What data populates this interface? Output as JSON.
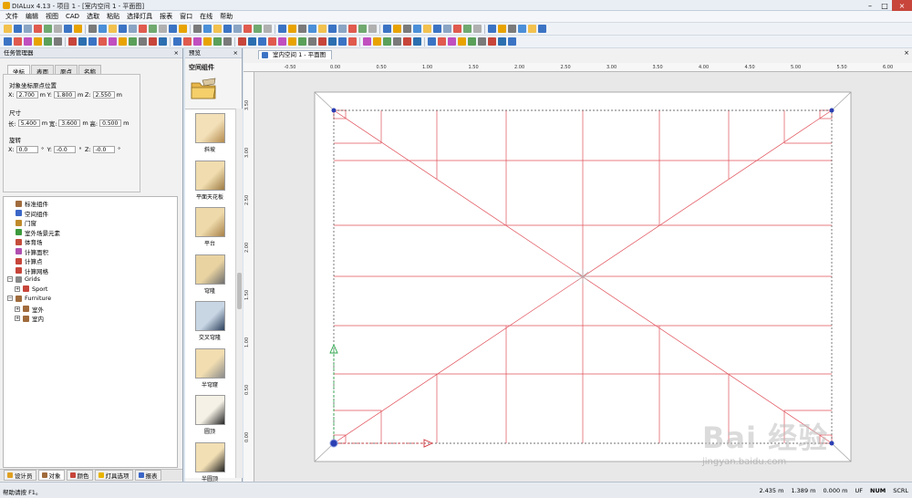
{
  "window": {
    "title": "DIALux 4.13 - 项目 1 - [室内空间 1 - 平面图]"
  },
  "menu": [
    "文件",
    "编辑",
    "视图",
    "CAD",
    "选取",
    "粘贴",
    "选择灯具",
    "报表",
    "窗口",
    "在线",
    "帮助"
  ],
  "task_manager": {
    "header": "任务管理器",
    "tabs": [
      "坐标",
      "表面",
      "原点",
      "名称"
    ],
    "position": {
      "title": "对象坐标原点位置",
      "x_label": "X:",
      "x": "2.700",
      "y_label": "Y:",
      "y": "1.800",
      "z_label": "Z:",
      "z": "2.550",
      "unit": "m"
    },
    "size": {
      "title": "尺寸",
      "l_label": "长:",
      "l": "5.400",
      "w_label": "宽:",
      "w": "3.600",
      "h_label": "高:",
      "h": "0.500",
      "unit": "m"
    },
    "rotation": {
      "title": "旋转",
      "x_label": "X:",
      "x": "0.0",
      "y_label": "Y:",
      "y": "-0.0",
      "z_label": "Z:",
      "z": "-0.0",
      "unit": "°"
    }
  },
  "tree": {
    "items": [
      {
        "label": "标准组件",
        "color": "#a06b3c"
      },
      {
        "label": "空间组件",
        "color": "#3a66c7"
      },
      {
        "label": "门窗",
        "color": "#c08a2a"
      },
      {
        "label": "室外场景元素",
        "color": "#3c9a3c"
      },
      {
        "label": "体育场",
        "color": "#c44d3a"
      },
      {
        "label": "计算面积",
        "color": "#b04fb0"
      },
      {
        "label": "计算点",
        "color": "#c7453a"
      },
      {
        "label": "计算网格",
        "color": "#c7453a"
      },
      {
        "label": "Grids",
        "color": "#888888"
      },
      {
        "label": "Sport",
        "color": "#c7453a"
      },
      {
        "label": "Furniture",
        "color": "#a06b3c"
      },
      {
        "label": "室外",
        "color": "#a06b3c"
      },
      {
        "label": "室内",
        "color": "#a06b3c"
      }
    ]
  },
  "bottom_tabs": [
    {
      "label": "设计员",
      "color": "#e0a020"
    },
    {
      "label": "对象",
      "color": "#a06b3c"
    },
    {
      "label": "颜色",
      "color": "#c7453a"
    },
    {
      "label": "灯具选项",
      "color": "#e8b400"
    },
    {
      "label": "报表",
      "color": "#3a66c7"
    }
  ],
  "preview": {
    "header": "预览",
    "close": "×",
    "title": "空间组件",
    "items": [
      {
        "label": "斜坡",
        "top": "#f3e0b8",
        "side": "#b48a4d"
      },
      {
        "label": "平面天花板",
        "top": "#f0dcae",
        "side": "#9c7a44"
      },
      {
        "label": "平台",
        "top": "#eed9aa",
        "side": "#a68048"
      },
      {
        "label": "穹隆",
        "top": "#e9d3a1",
        "side": "#6e6e6e"
      },
      {
        "label": "交叉穹隆",
        "top": "#c8d6e4",
        "side": "#2a3e5a"
      },
      {
        "label": "半穹窿",
        "top": "#f1ddb0",
        "side": "#8a8a8a"
      },
      {
        "label": "圆顶",
        "top": "#f5f1e6",
        "side": "#242424"
      },
      {
        "label": "半圆顶",
        "top": "#f2dfb4",
        "side": "#1e1e1e"
      }
    ]
  },
  "document": {
    "tab": "室内空间 1 - 平面图",
    "close": "×",
    "hruler": [
      "-0.50",
      "0.00",
      "0.50",
      "1.00",
      "1.50",
      "2.00",
      "2.50",
      "3.00",
      "3.50",
      "4.00",
      "4.50",
      "5.00",
      "5.50",
      "6.00"
    ],
    "vruler": [
      "3.50",
      "3.00",
      "2.50",
      "2.00",
      "1.50",
      "1.00",
      "0.50",
      "0.00"
    ]
  },
  "status": {
    "help": "帮助请按 F1。",
    "x": "2.435 m",
    "y": "1.389 m",
    "z": "0.000 m",
    "flags": [
      "UF",
      "NUM",
      "SCRL"
    ]
  },
  "watermark": {
    "brand": "Bai 经验",
    "url": "jingyan.baidu.com"
  }
}
